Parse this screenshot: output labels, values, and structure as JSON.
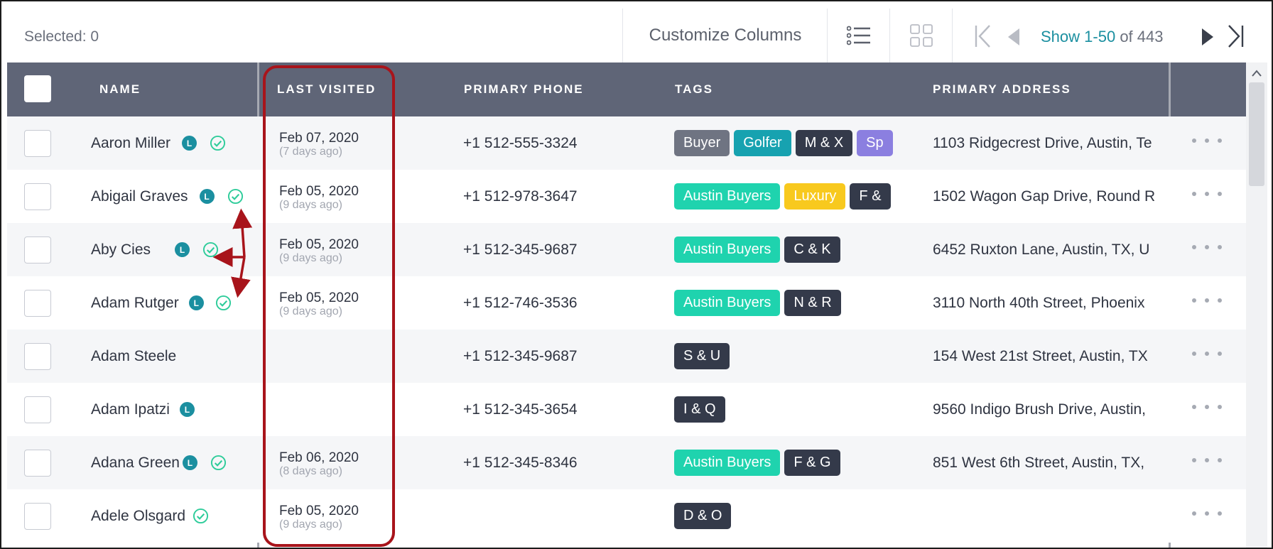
{
  "toolbar": {
    "selected_label": "Selected: 0",
    "customize_label": "Customize Columns",
    "list_view_icon": "list-view-icon",
    "grid_view_icon": "grid-view-icon",
    "pagination": {
      "show_text": "Show 1-50",
      "of_text": "of 443",
      "icons": [
        "first-page-icon",
        "prev-page-icon",
        "next-page-icon",
        "last-page-icon"
      ]
    }
  },
  "columns": {
    "name": "NAME",
    "last_visited": "LAST VISITED",
    "phone": "PRIMARY PHONE",
    "tags": "TAGS",
    "address": "PRIMARY ADDRESS"
  },
  "colors": {
    "header_bg": "#5f6577",
    "accent": "#1b8fa0",
    "annotation": "#a8141b",
    "tag_grey": "#6f7482",
    "tag_teal": "#17a2b0",
    "tag_dark": "#343a4a",
    "tag_purple": "#8b7fe0",
    "tag_green": "#1fd3ae",
    "tag_yellow": "#f8c91e",
    "verified_green": "#2ecc9a"
  },
  "rows": [
    {
      "name": "Aaron Miller",
      "badge": "L",
      "verified": true,
      "last_visited": "Feb 07, 2020",
      "last_visited_rel": "(7 days ago)",
      "phone": "+1 512-555-3324",
      "tags": [
        {
          "label": "Buyer",
          "color": "#6f7482"
        },
        {
          "label": "Golfer",
          "color": "#17a2b0"
        },
        {
          "label": "M & X",
          "color": "#343a4a"
        },
        {
          "label": "Sp",
          "color": "#8b7fe0"
        }
      ],
      "address": "1103 Ridgecrest Drive, Austin, Te"
    },
    {
      "name": "Abigail Graves",
      "badge": "L",
      "verified": true,
      "last_visited": "Feb 05, 2020",
      "last_visited_rel": "(9 days ago)",
      "phone": "+1 512-978-3647",
      "tags": [
        {
          "label": "Austin Buyers",
          "color": "#1fd3ae"
        },
        {
          "label": "Luxury",
          "color": "#f8c91e"
        },
        {
          "label": "F &",
          "color": "#343a4a"
        }
      ],
      "address": "1502 Wagon Gap Drive, Round R"
    },
    {
      "name": "Aby Cies",
      "badge": "L",
      "verified": true,
      "last_visited": "Feb 05, 2020",
      "last_visited_rel": "(9 days ago)",
      "phone": "+1 512-345-9687",
      "tags": [
        {
          "label": "Austin Buyers",
          "color": "#1fd3ae"
        },
        {
          "label": "C & K",
          "color": "#343a4a"
        }
      ],
      "address": "6452 Ruxton Lane, Austin, TX, U"
    },
    {
      "name": "Adam Rutger",
      "badge": "L",
      "verified": true,
      "last_visited": "Feb 05, 2020",
      "last_visited_rel": "(9 days ago)",
      "phone": "+1 512-746-3536",
      "tags": [
        {
          "label": "Austin Buyers",
          "color": "#1fd3ae"
        },
        {
          "label": "N & R",
          "color": "#343a4a"
        }
      ],
      "address": "3110 North 40th Street, Phoenix"
    },
    {
      "name": "Adam Steele",
      "badge": "",
      "verified": false,
      "last_visited": "",
      "last_visited_rel": "",
      "phone": "+1 512-345-9687",
      "tags": [
        {
          "label": "S & U",
          "color": "#343a4a"
        }
      ],
      "address": "154 West 21st Street, Austin, TX"
    },
    {
      "name": "Adam Ipatzi",
      "badge": "L",
      "verified": false,
      "last_visited": "",
      "last_visited_rel": "",
      "phone": "+1 512-345-3654",
      "tags": [
        {
          "label": "I & Q",
          "color": "#343a4a"
        }
      ],
      "address": "9560 Indigo Brush Drive, Austin,"
    },
    {
      "name": "Adana Green",
      "badge": "L",
      "verified": true,
      "last_visited": "Feb 06, 2020",
      "last_visited_rel": "(8 days ago)",
      "phone": "+1 512-345-8346",
      "tags": [
        {
          "label": "Austin Buyers",
          "color": "#1fd3ae"
        },
        {
          "label": "F & G",
          "color": "#343a4a"
        }
      ],
      "address": "851 West 6th Street, Austin, TX,"
    },
    {
      "name": "Adele Olsgard",
      "badge": "",
      "verified": true,
      "last_visited": "Feb 05, 2020",
      "last_visited_rel": "(9 days ago)",
      "phone": "",
      "tags": [
        {
          "label": "D & O",
          "color": "#343a4a"
        }
      ],
      "address": ""
    }
  ]
}
